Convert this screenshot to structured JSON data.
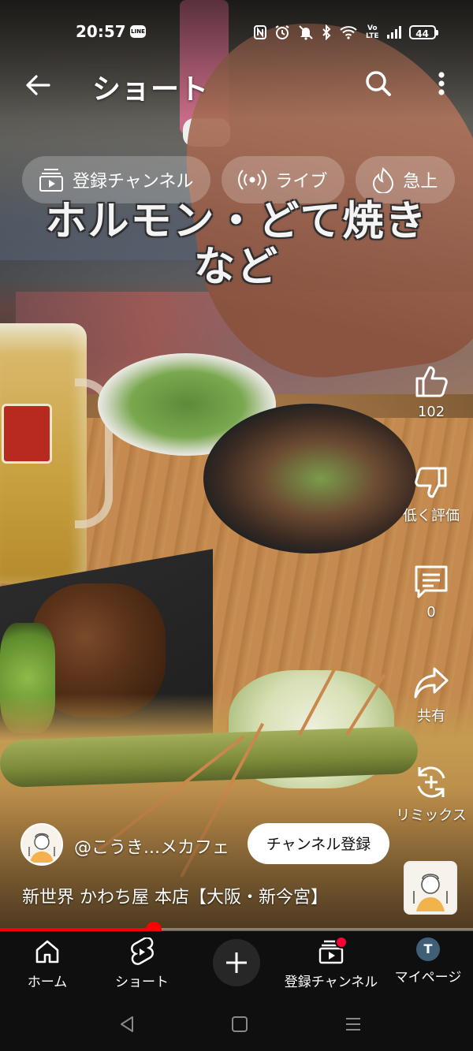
{
  "status_bar": {
    "time": "20:57",
    "line_badge": "LINE",
    "icons": [
      "nfc-icon",
      "alarm-icon",
      "mute-icon",
      "bluetooth-icon",
      "wifi-icon",
      "volte-icon",
      "signal-icon"
    ],
    "volte_label": "Vo\nLTE",
    "battery": "44"
  },
  "header": {
    "title": "ショート",
    "back_icon": "arrow-left-icon",
    "search_icon": "search-icon",
    "more_icon": "more-vertical-icon"
  },
  "chips": [
    {
      "icon": "subscriptions-icon",
      "label": "登録チャンネル"
    },
    {
      "icon": "live-icon",
      "label": "ライブ"
    },
    {
      "icon": "trending-icon",
      "label": "急上"
    }
  ],
  "caption": {
    "line1": "ホルモン・どて焼き",
    "line2": "など"
  },
  "actions": {
    "like": {
      "icon": "thumbs-up-icon",
      "label": "102"
    },
    "dislike": {
      "icon": "thumbs-down-icon",
      "label": "低く評価"
    },
    "comments": {
      "icon": "comment-icon",
      "label": "0"
    },
    "share": {
      "icon": "share-icon",
      "label": "共有"
    },
    "remix": {
      "icon": "remix-icon",
      "label": "リミックス"
    }
  },
  "channel": {
    "handle": "@こうき...メカフェ",
    "subscribe_label": "チャンネル登録"
  },
  "video_title": "新世界 かわち屋 本店【大阪・新今宮】",
  "progress": {
    "fraction": 0.325
  },
  "nav": {
    "home": "ホーム",
    "shorts": "ショート",
    "create_icon": "plus-icon",
    "subscriptions": "登録チャンネル",
    "account": "マイページ",
    "account_initial": "T"
  },
  "colors": {
    "accent": "#ff0000",
    "nav_bg": "#0f0f0f",
    "notification_dot": "#ff0033"
  }
}
